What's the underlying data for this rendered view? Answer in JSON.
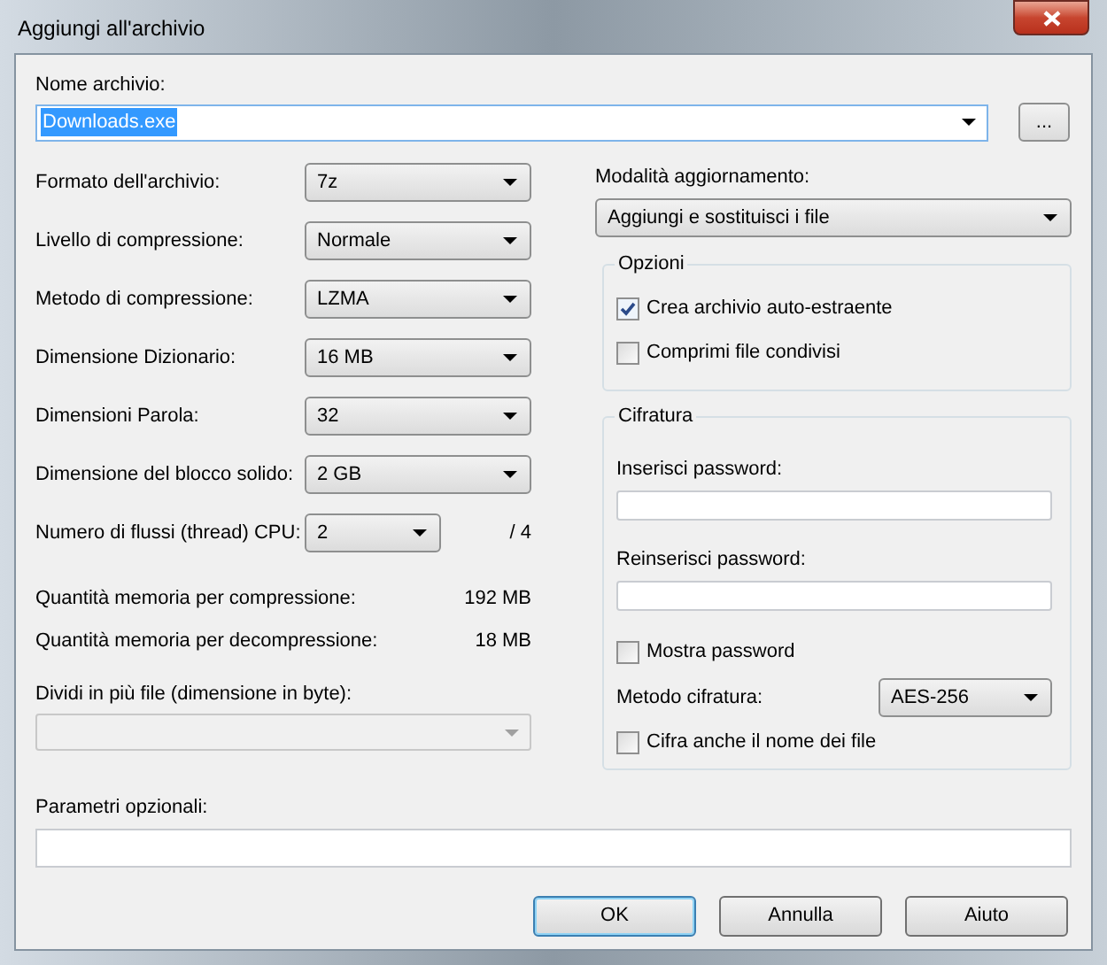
{
  "window": {
    "title": "Aggiungi all'archivio"
  },
  "archive_name": {
    "label": "Nome archivio:",
    "value": "Downloads.exe",
    "value_selected": true,
    "browse": "..."
  },
  "settings": [
    {
      "label": "Formato dell'archivio:",
      "value": "7z"
    },
    {
      "label": "Livello di compressione:",
      "value": "Normale"
    },
    {
      "label": "Metodo di compressione:",
      "value": "LZMA"
    },
    {
      "label": "Dimensione Dizionario:",
      "value": "16 MB"
    },
    {
      "label": "Dimensioni Parola:",
      "value": "32"
    },
    {
      "label": "Dimensione del blocco solido:",
      "value": "2 GB"
    }
  ],
  "threads": {
    "label": "Numero di flussi (thread) CPU:",
    "value": "2",
    "max": "/ 4"
  },
  "memory": [
    {
      "label": "Quantità memoria per compressione:",
      "value": "192 MB"
    },
    {
      "label": "Quantità memoria per decompressione:",
      "value": "18 MB"
    }
  ],
  "split": {
    "label": "Dividi in più file (dimensione in byte):",
    "disabled": true
  },
  "update_mode": {
    "label": "Modalità aggiornamento:",
    "value": "Aggiungi e sostituisci i file"
  },
  "options": {
    "title": "Opzioni",
    "items": [
      {
        "label": "Crea archivio auto-estraente",
        "checked": true
      },
      {
        "label": "Comprimi file condivisi",
        "checked": false
      }
    ]
  },
  "encryption": {
    "title": "Cifratura",
    "items": [
      {
        "kind": "field",
        "label": "Inserisci password:"
      },
      {
        "kind": "field",
        "label": "Reinserisci password:"
      },
      {
        "kind": "checkbox",
        "label": "Mostra password",
        "checked": false
      },
      {
        "kind": "combo",
        "label": "Metodo cifratura:",
        "value": "AES-256"
      },
      {
        "kind": "checkbox",
        "label": "Cifra anche il nome dei file",
        "checked": false
      }
    ]
  },
  "optional_params": {
    "label": "Parametri opzionali:"
  },
  "buttons": [
    {
      "label": "OK",
      "default": true
    },
    {
      "label": "Annulla",
      "default": false
    },
    {
      "label": "Aiuto",
      "default": false
    }
  ]
}
